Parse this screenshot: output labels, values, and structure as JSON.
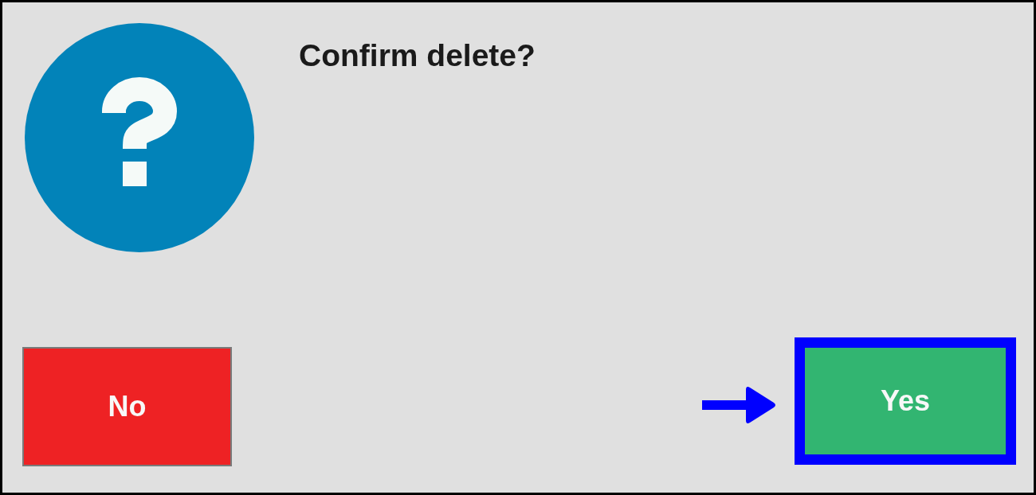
{
  "dialog": {
    "message": "Confirm delete?"
  },
  "buttons": [
    {
      "label": "No",
      "kind": "cancel",
      "selected": false
    },
    {
      "label": "Yes",
      "kind": "confirm",
      "selected": true
    }
  ]
}
